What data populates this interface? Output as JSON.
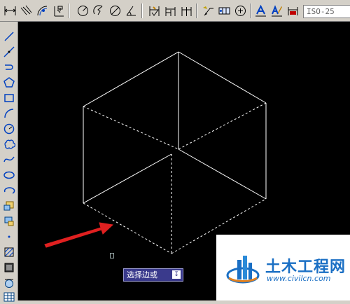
{
  "toolbar_top": {
    "items": [
      {
        "name": "linear-dimension-icon"
      },
      {
        "name": "aligned-dimension-icon"
      },
      {
        "name": "arc-length-dimension-icon"
      },
      {
        "name": "ordinate-dimension-icon"
      },
      {
        "name": "radius-dimension-icon"
      },
      {
        "name": "jogged-dimension-icon"
      },
      {
        "name": "diameter-dimension-icon"
      },
      {
        "name": "angular-dimension-icon"
      },
      {
        "name": "quick-dimension-icon"
      },
      {
        "name": "baseline-dimension-icon"
      },
      {
        "name": "continue-dimension-icon"
      },
      {
        "name": "quick-leader-icon"
      },
      {
        "name": "tolerance-icon"
      },
      {
        "name": "center-mark-icon"
      },
      {
        "name": "dimension-edit-icon"
      },
      {
        "name": "dimension-text-edit-icon"
      },
      {
        "name": "dimension-update-icon"
      }
    ],
    "dimstyle_value": "ISO-25"
  },
  "toolbar_left": {
    "items": [
      {
        "name": "line-icon"
      },
      {
        "name": "construction-line-icon"
      },
      {
        "name": "polyline-icon"
      },
      {
        "name": "polygon-icon"
      },
      {
        "name": "rectangle-icon"
      },
      {
        "name": "arc-icon"
      },
      {
        "name": "circle-icon"
      },
      {
        "name": "revision-cloud-icon"
      },
      {
        "name": "spline-icon"
      },
      {
        "name": "ellipse-icon"
      },
      {
        "name": "ellipse-arc-icon"
      },
      {
        "name": "insert-block-icon"
      },
      {
        "name": "make-block-icon"
      },
      {
        "name": "point-icon"
      },
      {
        "name": "hatch-icon"
      },
      {
        "name": "gradient-icon"
      },
      {
        "name": "region-icon"
      },
      {
        "name": "table-icon"
      }
    ]
  },
  "command_tooltip": {
    "text": "选择边或",
    "enter_icon": "enter-down-arrow-icon"
  },
  "watermark": {
    "title": "土木工程网",
    "url": "www.civilcn.com"
  },
  "colors": {
    "canvas_bg": "#000000",
    "drawing_lines": "#ffffff",
    "arrow": "#e02020",
    "tooltip_bg": "#3a3a8c",
    "watermark_blue": "#1a6fc4"
  }
}
